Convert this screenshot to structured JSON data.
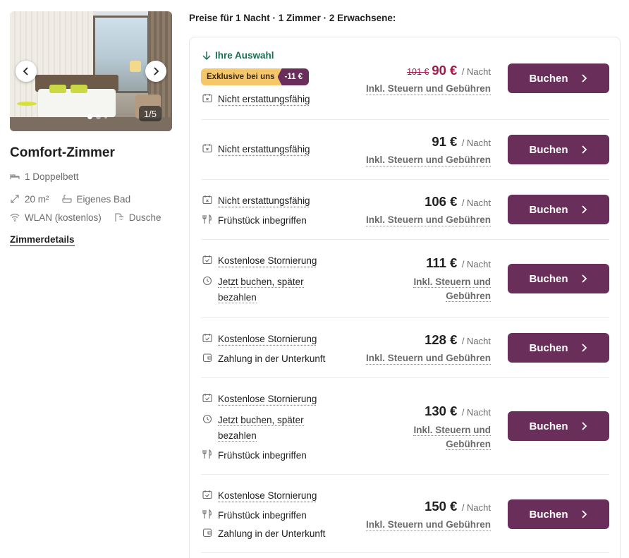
{
  "room": {
    "name": "Comfort-Zimmer",
    "photo_counter": "1/5",
    "bed": "1 Doppelbett",
    "size": "20 m²",
    "bath": "Eigenes Bad",
    "wifi": "WLAN (kostenlos)",
    "shower": "Dusche",
    "details_link": "Zimmerdetails"
  },
  "header": "Preise für 1 Nacht · 1 Zimmer · 2 Erwachsene:",
  "offers": {
    "selection_label": "Ihre Auswahl",
    "badge_exclusive": "Exklusive bei uns",
    "badge_discount": "-11 €",
    "per_night": "/ Nacht",
    "tax_note": "Inkl. Steuern und Gebühren",
    "tax_note_line1": "Inkl. Steuern und",
    "tax_note_line2": "Gebühren",
    "book_label": "Buchen",
    "old_price": "101 €",
    "rows": [
      {
        "price": "90 €",
        "conditions": [
          "Nicht erstattungsfähig"
        ]
      },
      {
        "price": "91 €",
        "conditions": [
          "Nicht erstattungsfähig"
        ]
      },
      {
        "price": "106 €",
        "conditions": [
          "Nicht erstattungsfähig",
          "Frühstück inbegriffen"
        ]
      },
      {
        "price": "111 €",
        "conditions": [
          "Kostenlose Stornierung",
          "Jetzt buchen, später",
          "bezahlen"
        ]
      },
      {
        "price": "128 €",
        "conditions": [
          "Kostenlose Stornierung",
          "Zahlung in der Unterkunft"
        ]
      },
      {
        "price": "130 €",
        "conditions": [
          "Kostenlose Stornierung",
          "Jetzt buchen, später",
          "bezahlen",
          "Frühstück inbegriffen"
        ]
      },
      {
        "price": "150 €",
        "conditions": [
          "Kostenlose Stornierung",
          "Frühstück inbegriffen",
          "Zahlung in der Unterkunft"
        ]
      }
    ]
  },
  "colors": {
    "brand": "#6a2e5b",
    "selection": "#1d6f50",
    "discount_price": "#a3174b",
    "badge_yellow": "#f6c76a"
  }
}
